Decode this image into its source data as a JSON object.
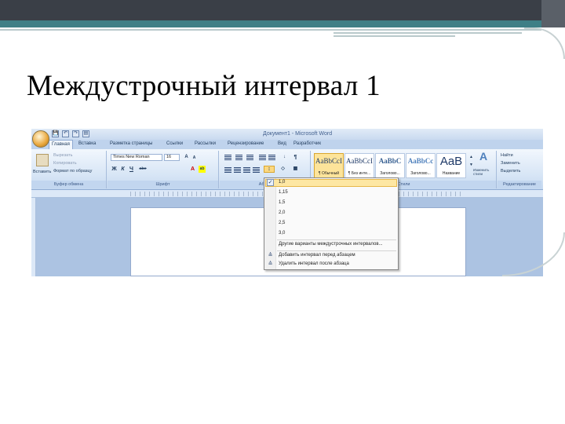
{
  "slide": {
    "title": "Междустрочный интервал 1"
  },
  "word": {
    "window_title": "Документ1 - Microsoft Word",
    "qat": {
      "save": "💾",
      "undo": "↶",
      "redo": "↷",
      "print": "▤"
    },
    "tabs": [
      "Главная",
      "Вставка",
      "Разметка страницы",
      "Ссылки",
      "Рассылки",
      "Рецензирование",
      "Вид",
      "Разработчик"
    ],
    "clipboard": {
      "paste": "Вставить",
      "cut": "Вырезать",
      "copy": "Копировать",
      "format_painter": "Формат по образцу",
      "label": "Буфер обмена"
    },
    "font": {
      "name": "Times New Roman",
      "size": "16",
      "bold": "Ж",
      "italic": "К",
      "underline": "Ч",
      "grow": "A",
      "shrink": "A",
      "strike": "abe",
      "label": "Шрифт"
    },
    "paragraph": {
      "label": "Абзац"
    },
    "styles": {
      "items": [
        {
          "sample": "AaBbCcI",
          "name": "¶ Обычный",
          "selected": true
        },
        {
          "sample": "AaBbCcI",
          "name": "¶ Без инте...",
          "selected": false
        },
        {
          "sample": "AaBbC",
          "name": "Заголово...",
          "selected": false
        },
        {
          "sample": "AaBbCc",
          "name": "Заголово...",
          "selected": false
        },
        {
          "sample": "AaB",
          "name": "Название",
          "selected": false
        }
      ],
      "change": "Изменить стили",
      "label": "Стили"
    },
    "editing": {
      "find": "Найти",
      "replace": "Заменить",
      "select": "Выделить",
      "label": "Редактирование"
    },
    "line_spacing_menu": {
      "options": [
        "1,0",
        "1,15",
        "1,5",
        "2,0",
        "2,5",
        "3,0"
      ],
      "selected": "1,0",
      "check": "✓",
      "more": "Другие варианты междустрочных интервалов...",
      "add_before": "Добавить интервал перед абзацем",
      "remove_after": "Удалить интервал после абзаца"
    }
  }
}
